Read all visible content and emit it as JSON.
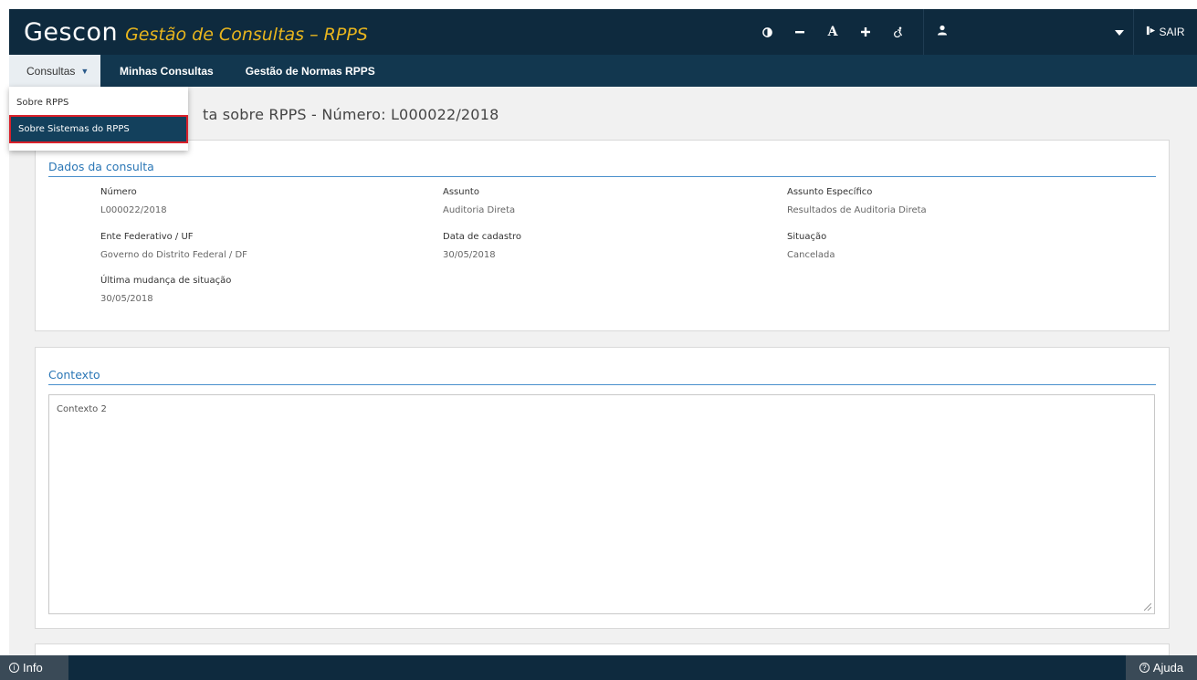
{
  "header": {
    "brand": "Gescon",
    "subtitle": "Gestão de Consultas – RPPS",
    "accessibility": {
      "contrast_icon": "contrast-icon",
      "decrease_icon": "minus-icon",
      "font_label": "A",
      "increase_icon": "plus-icon",
      "accessibility_icon": "accessibility-icon"
    },
    "user_icon": "user-icon",
    "logout_label": "SAIR"
  },
  "nav": {
    "items": [
      {
        "label": "Consultas"
      },
      {
        "label": "Minhas Consultas"
      },
      {
        "label": "Gestão de Normas RPPS"
      }
    ]
  },
  "dropdown": {
    "items": [
      {
        "label": "Sobre RPPS"
      },
      {
        "label": "Sobre Sistemas do RPPS"
      }
    ]
  },
  "page": {
    "title_visible": "ta sobre RPPS - Número: L000022/2018"
  },
  "dados": {
    "title": "Dados da consulta",
    "fields": [
      {
        "label": "Número",
        "value": "L000022/2018"
      },
      {
        "label": "Assunto",
        "value": "Auditoria Direta"
      },
      {
        "label": "Assunto Específico",
        "value": "Resultados de Auditoria Direta"
      },
      {
        "label": "Ente Federativo / UF",
        "value": "Governo do Distrito Federal / DF"
      },
      {
        "label": "Data de cadastro",
        "value": "30/05/2018"
      },
      {
        "label": "Situação",
        "value": "Cancelada"
      },
      {
        "label": "Última mudança de situação",
        "value": "30/05/2018"
      }
    ]
  },
  "contexto": {
    "title": "Contexto",
    "text": "Contexto 2"
  },
  "footer": {
    "info_label": "Info",
    "help_label": "Ajuda"
  },
  "colors": {
    "topbar": "#0e2a3e",
    "navbar": "#12374f",
    "accent_yellow": "#e8b51e",
    "section_blue": "#2b77b6",
    "highlight_red": "#d9202a"
  }
}
